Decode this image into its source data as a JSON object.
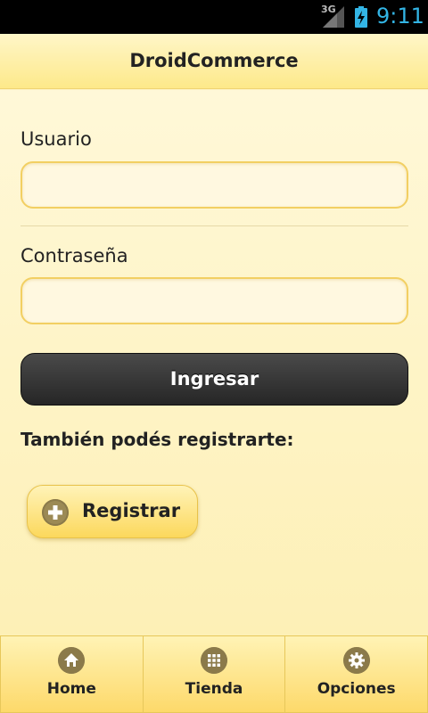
{
  "status_bar": {
    "network": "3G",
    "time": "9:11"
  },
  "header": {
    "title": "DroidCommerce"
  },
  "login": {
    "user_label": "Usuario",
    "user_value": "",
    "password_label": "Contraseña",
    "password_value": "",
    "submit_label": "Ingresar"
  },
  "register": {
    "prompt": "También podés registrarte:",
    "button_label": "Registrar"
  },
  "navbar": {
    "items": [
      {
        "label": "Home",
        "icon": "home-icon"
      },
      {
        "label": "Tienda",
        "icon": "grid-icon"
      },
      {
        "label": "Opciones",
        "icon": "gear-icon"
      }
    ]
  },
  "colors": {
    "accent": "#33b5e5",
    "background": "#fdf3c4",
    "input_border": "#f2cf62",
    "primary_button": "#2f2f2f",
    "icon": "#8b7a4a"
  }
}
